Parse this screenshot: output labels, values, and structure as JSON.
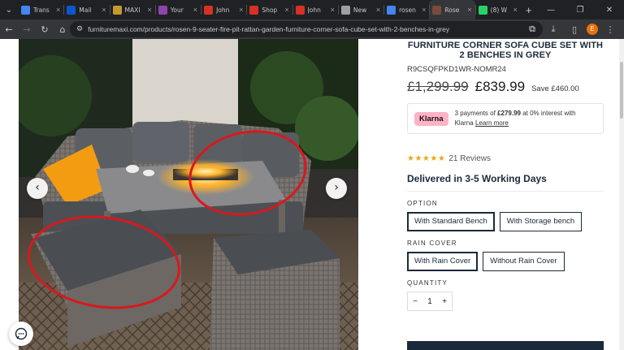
{
  "browser": {
    "tabs": [
      {
        "title": "Trans",
        "color": "#4285f4",
        "active": false
      },
      {
        "title": "Mail",
        "color": "#0b57d0",
        "active": false
      },
      {
        "title": "MAXI",
        "color": "#c49a2a",
        "active": false
      },
      {
        "title": "Your",
        "color": "#8e44ad",
        "active": false
      },
      {
        "title": "John",
        "color": "#d93025",
        "active": false
      },
      {
        "title": "Shop",
        "color": "#d93025",
        "active": false
      },
      {
        "title": "John",
        "color": "#d93025",
        "active": false
      },
      {
        "title": "New",
        "color": "#9aa0a6",
        "active": false
      },
      {
        "title": "rosen",
        "color": "#4285f4",
        "active": false
      },
      {
        "title": "Rose",
        "color": "#7a4b3a",
        "active": true
      },
      {
        "title": "(8) W",
        "color": "#25d366",
        "active": false
      }
    ],
    "url": "furnituremaxi.com/products/rosen-9-seater-fire-pit-rattan-garden-furniture-corner-sofa-cube-set-with-2-benches-in-grey",
    "profile_initial": "E"
  },
  "product": {
    "title": "FURNITURE CORNER SOFA CUBE SET WITH 2 BENCHES IN GREY",
    "sku": "R9CSQFPKD1WR-NOMR24",
    "old_price": "£1,299.99",
    "new_price": "£839.99",
    "save": "Save £460.00",
    "klarna": {
      "badge": "Klarna",
      "text_prefix": "3 payments of ",
      "amount": "£279.99",
      "text_suffix": " at 0% interest with",
      "text_line2": "Klarna ",
      "link": "Learn more"
    },
    "rating": {
      "stars": 5,
      "reviews": "21 Reviews"
    },
    "delivery": "Delivered in 3-5 Working Days",
    "option": {
      "label": "OPTION",
      "choices": [
        "With Standard Bench",
        "With Storage bench"
      ],
      "selected": 0
    },
    "rain_cover": {
      "label": "RAIN COVER",
      "choices": [
        "With Rain Cover",
        "Without Rain Cover"
      ],
      "selected": 0
    },
    "quantity": {
      "label": "QUANTITY",
      "value": "1",
      "minus": "−",
      "plus": "+"
    }
  },
  "colors": {
    "brand_navy": "#1b2a3a",
    "klarna_pink": "#ffb3c7",
    "star_gold": "#e9a712",
    "annotation_red": "#d8181e"
  },
  "icons": {
    "gallery_prev": "‹",
    "gallery_next": "›"
  }
}
